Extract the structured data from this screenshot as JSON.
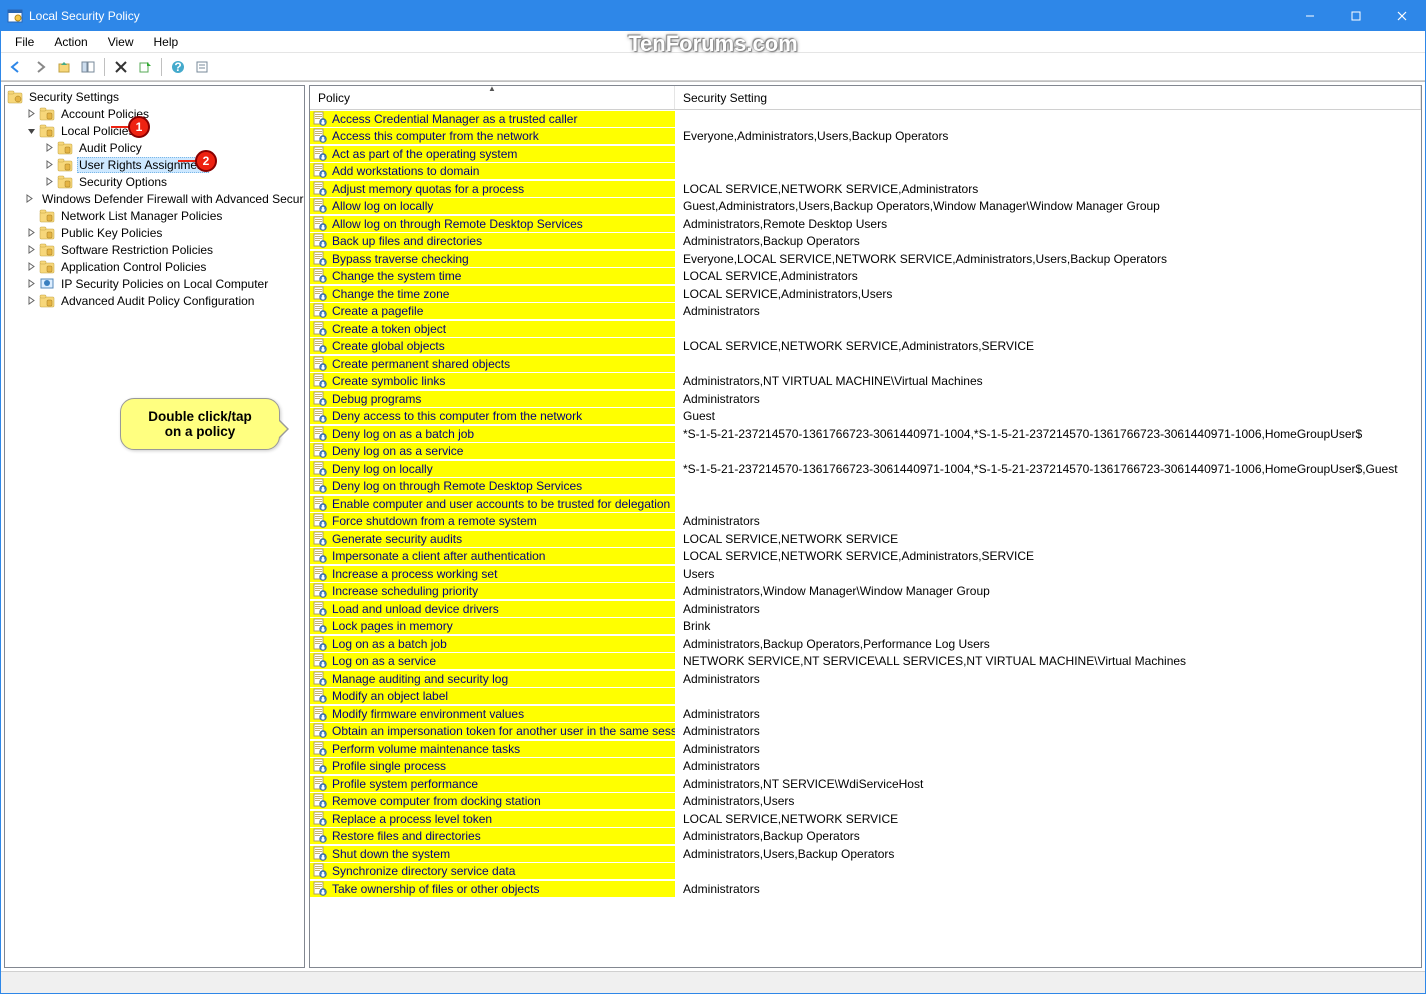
{
  "window": {
    "title": "Local Security Policy"
  },
  "menu": {
    "file": "File",
    "action": "Action",
    "view": "View",
    "help": "Help"
  },
  "watermark": "TenForums.com",
  "tree": {
    "root": "Security Settings",
    "items": [
      {
        "label": "Account Policies",
        "depth": 1,
        "expander": "closed"
      },
      {
        "label": "Local Policies",
        "depth": 1,
        "expander": "open"
      },
      {
        "label": "Audit Policy",
        "depth": 2,
        "expander": "closed"
      },
      {
        "label": "User Rights Assignment",
        "depth": 2,
        "expander": "closed",
        "selected": true
      },
      {
        "label": "Security Options",
        "depth": 2,
        "expander": "closed"
      },
      {
        "label": "Windows Defender Firewall with Advanced Security",
        "depth": 1,
        "expander": "closed"
      },
      {
        "label": "Network List Manager Policies",
        "depth": 1,
        "expander": "none"
      },
      {
        "label": "Public Key Policies",
        "depth": 1,
        "expander": "closed"
      },
      {
        "label": "Software Restriction Policies",
        "depth": 1,
        "expander": "closed"
      },
      {
        "label": "Application Control Policies",
        "depth": 1,
        "expander": "closed"
      },
      {
        "label": "IP Security Policies on Local Computer",
        "depth": 1,
        "expander": "closed",
        "icon": "ipsec"
      },
      {
        "label": "Advanced Audit Policy Configuration",
        "depth": 1,
        "expander": "closed"
      }
    ]
  },
  "columns": {
    "policy": "Policy",
    "setting": "Security Setting"
  },
  "policies": [
    {
      "name": "Access Credential Manager as a trusted caller",
      "setting": ""
    },
    {
      "name": "Access this computer from the network",
      "setting": "Everyone,Administrators,Users,Backup Operators"
    },
    {
      "name": "Act as part of the operating system",
      "setting": ""
    },
    {
      "name": "Add workstations to domain",
      "setting": ""
    },
    {
      "name": "Adjust memory quotas for a process",
      "setting": "LOCAL SERVICE,NETWORK SERVICE,Administrators"
    },
    {
      "name": "Allow log on locally",
      "setting": "Guest,Administrators,Users,Backup Operators,Window Manager\\Window Manager Group"
    },
    {
      "name": "Allow log on through Remote Desktop Services",
      "setting": "Administrators,Remote Desktop Users"
    },
    {
      "name": "Back up files and directories",
      "setting": "Administrators,Backup Operators"
    },
    {
      "name": "Bypass traverse checking",
      "setting": "Everyone,LOCAL SERVICE,NETWORK SERVICE,Administrators,Users,Backup Operators"
    },
    {
      "name": "Change the system time",
      "setting": "LOCAL SERVICE,Administrators"
    },
    {
      "name": "Change the time zone",
      "setting": "LOCAL SERVICE,Administrators,Users"
    },
    {
      "name": "Create a pagefile",
      "setting": "Administrators"
    },
    {
      "name": "Create a token object",
      "setting": ""
    },
    {
      "name": "Create global objects",
      "setting": "LOCAL SERVICE,NETWORK SERVICE,Administrators,SERVICE"
    },
    {
      "name": "Create permanent shared objects",
      "setting": ""
    },
    {
      "name": "Create symbolic links",
      "setting": "Administrators,NT VIRTUAL MACHINE\\Virtual Machines"
    },
    {
      "name": "Debug programs",
      "setting": "Administrators"
    },
    {
      "name": "Deny access to this computer from the network",
      "setting": "Guest"
    },
    {
      "name": "Deny log on as a batch job",
      "setting": "*S-1-5-21-237214570-1361766723-3061440971-1004,*S-1-5-21-237214570-1361766723-3061440971-1006,HomeGroupUser$"
    },
    {
      "name": "Deny log on as a service",
      "setting": ""
    },
    {
      "name": "Deny log on locally",
      "setting": "*S-1-5-21-237214570-1361766723-3061440971-1004,*S-1-5-21-237214570-1361766723-3061440971-1006,HomeGroupUser$,Guest"
    },
    {
      "name": "Deny log on through Remote Desktop Services",
      "setting": ""
    },
    {
      "name": "Enable computer and user accounts to be trusted for delegation",
      "setting": ""
    },
    {
      "name": "Force shutdown from a remote system",
      "setting": "Administrators"
    },
    {
      "name": "Generate security audits",
      "setting": "LOCAL SERVICE,NETWORK SERVICE"
    },
    {
      "name": "Impersonate a client after authentication",
      "setting": "LOCAL SERVICE,NETWORK SERVICE,Administrators,SERVICE"
    },
    {
      "name": "Increase a process working set",
      "setting": "Users"
    },
    {
      "name": "Increase scheduling priority",
      "setting": "Administrators,Window Manager\\Window Manager Group"
    },
    {
      "name": "Load and unload device drivers",
      "setting": "Administrators"
    },
    {
      "name": "Lock pages in memory",
      "setting": "Brink"
    },
    {
      "name": "Log on as a batch job",
      "setting": "Administrators,Backup Operators,Performance Log Users"
    },
    {
      "name": "Log on as a service",
      "setting": "NETWORK SERVICE,NT SERVICE\\ALL SERVICES,NT VIRTUAL MACHINE\\Virtual Machines"
    },
    {
      "name": "Manage auditing and security log",
      "setting": "Administrators"
    },
    {
      "name": "Modify an object label",
      "setting": ""
    },
    {
      "name": "Modify firmware environment values",
      "setting": "Administrators"
    },
    {
      "name": "Obtain an impersonation token for another user in the same session",
      "setting": "Administrators"
    },
    {
      "name": "Perform volume maintenance tasks",
      "setting": "Administrators"
    },
    {
      "name": "Profile single process",
      "setting": "Administrators"
    },
    {
      "name": "Profile system performance",
      "setting": "Administrators,NT SERVICE\\WdiServiceHost"
    },
    {
      "name": "Remove computer from docking station",
      "setting": "Administrators,Users"
    },
    {
      "name": "Replace a process level token",
      "setting": "LOCAL SERVICE,NETWORK SERVICE"
    },
    {
      "name": "Restore files and directories",
      "setting": "Administrators,Backup Operators"
    },
    {
      "name": "Shut down the system",
      "setting": "Administrators,Users,Backup Operators"
    },
    {
      "name": "Synchronize directory service data",
      "setting": ""
    },
    {
      "name": "Take ownership of files or other objects",
      "setting": "Administrators"
    }
  ],
  "annotations": {
    "badge1": "1",
    "badge2": "2",
    "callout": "Double click/tap\non a policy"
  }
}
